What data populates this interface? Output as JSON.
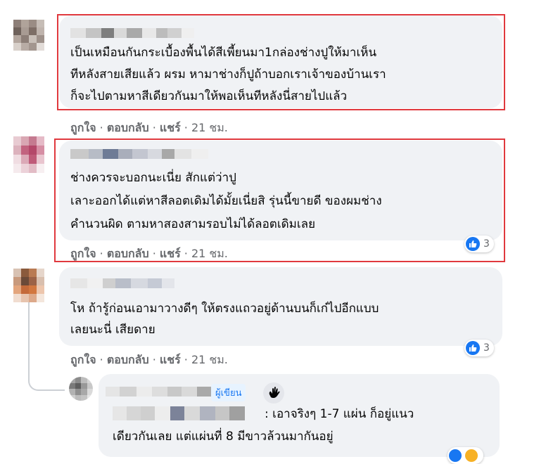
{
  "comments": [
    {
      "text_lines": [
        "เป็นเหมือนกันกระเบื้องพื้นได้สีเพี้ยนมา1กล่องช่างปูให้มาเห็น",
        "ทีหลังสายเสียแล้ว ผรม หามาช่างก็ปูถ้าบอกเราเจ้าของบ้านเรา",
        "ก็จะไปตามหาสีเดียวกันมาให้พอเห็นทีหลังนี่สายไปแล้ว"
      ],
      "like": "ถูกใจ",
      "reply": "ตอบกลับ",
      "share": "แชร์",
      "time": "21 ชม."
    },
    {
      "text_lines": [
        "ช่างควรจะบอกนะเนี่ย สักแต่ว่าปู",
        "เลาะออกได้แต่หาสีลอตเดิมได้มั้ยเนี่ยสิ รุ่นนี้ขายดี ของผมช่าง",
        "คำนวนผิด ตามหาสองสามรอบไม่ได้ลอตเดิมเลย"
      ],
      "like": "ถูกใจ",
      "reply": "ตอบกลับ",
      "share": "แชร์",
      "time": "21 ชม.",
      "reaction_count": "3"
    },
    {
      "text_lines": [
        "โห ถ้ารู้ก่อนเอามาวางดีๆ ให้ตรงแถวอยู่ด้านบนก็เก๋ไปอีกแบบ",
        "เลยนะนี่ เสียดาย"
      ],
      "like": "ถูกใจ",
      "reply": "ตอบกลับ",
      "share": "แชร์",
      "time": "21 ชม.",
      "reaction_count": "3"
    }
  ],
  "reply": {
    "author_badge": "ผู้เขียน",
    "text_lines": [
      ": เอาจริงๆ 1-7 แผ่น ก็อยู่แนว",
      "เดียวกันเลย แต่แผ่นที่ 8 มีขาวล้วนมากันอยู่"
    ]
  },
  "colors": {
    "highlight": "#e0393e",
    "bubble": "#f0f2f5",
    "meta": "#65676b",
    "like_blue": "#1877f2"
  },
  "icons": [
    "like-icon",
    "wave-icon",
    "haha-icon"
  ]
}
